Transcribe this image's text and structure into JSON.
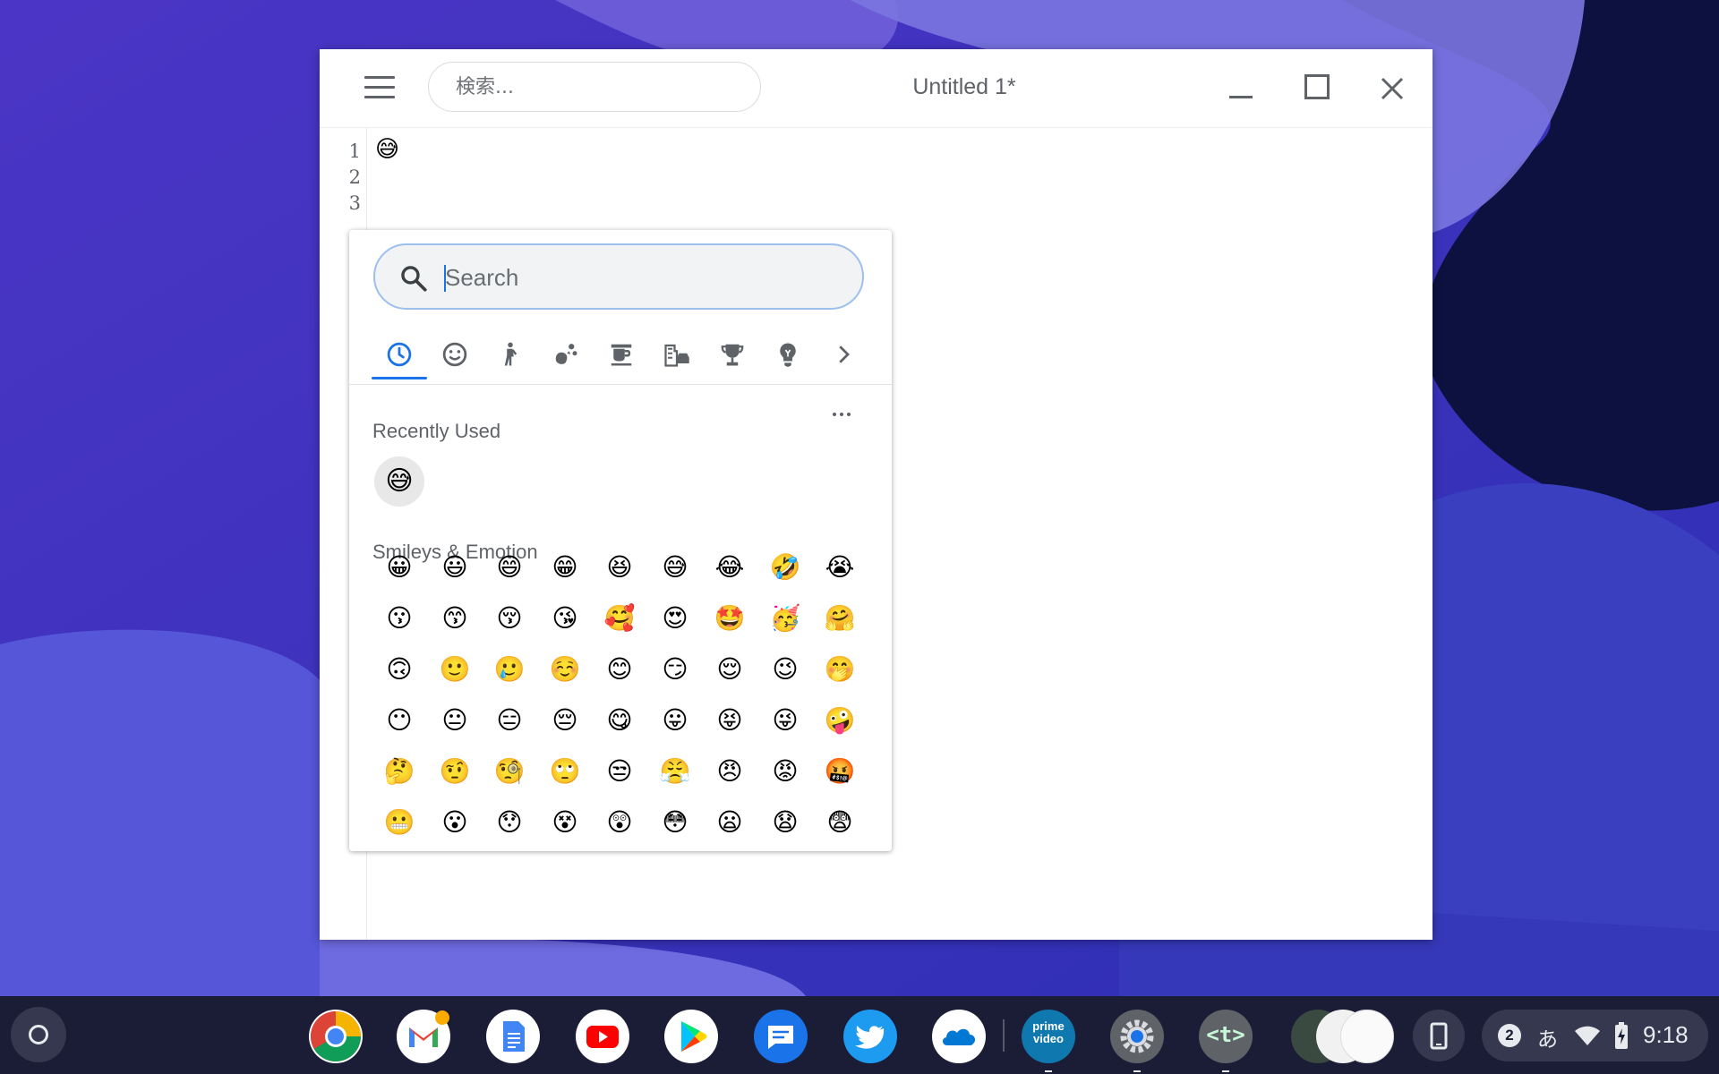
{
  "window": {
    "search_placeholder": "検索...",
    "title": "Untitled 1*"
  },
  "editor": {
    "line_numbers": [
      "1",
      "2",
      "3"
    ],
    "content": "😅"
  },
  "emoji_picker": {
    "search_placeholder": "Search",
    "category_icons": [
      "clock-icon",
      "smiley-icon",
      "person-icon",
      "animal-icon",
      "food-icon",
      "travel-icon",
      "trophy-icon",
      "lightbulb-icon",
      "chevron-right-icon"
    ],
    "recently_used_title": "Recently Used",
    "recently_used": [
      "😅"
    ],
    "smileys_title": "Smileys & Emotion",
    "smileys": [
      "😀",
      "😃",
      "😄",
      "😁",
      "😆",
      "😅",
      "😂",
      "🤣",
      "😭",
      "😗",
      "😙",
      "😚",
      "😘",
      "🥰",
      "😍",
      "🤩",
      "🥳",
      "🤗",
      "🙃",
      "🙂",
      "🥲",
      "☺️",
      "😊",
      "😏",
      "😌",
      "😉",
      "🤭",
      "😶",
      "😐",
      "😑",
      "😔",
      "😋",
      "😛",
      "😝",
      "😜",
      "🤪",
      "🤔",
      "🤨",
      "🧐",
      "🙄",
      "😒",
      "😤",
      "😠",
      "😡",
      "🤬",
      "😬",
      "😮",
      "😯",
      "😵",
      "😲",
      "😳",
      "😦",
      "😧",
      "😨"
    ],
    "accent_color": "#1a73e8"
  },
  "shelf": {
    "apps": [
      "chrome-icon",
      "gmail-icon",
      "docs-icon",
      "youtube-icon",
      "play-store-icon",
      "messages-icon",
      "twitter-icon",
      "onedrive-icon",
      "prime-video-icon",
      "settings-icon",
      "text-app-icon"
    ],
    "prime_video_label": "prime video",
    "text_app_label": "<t>",
    "notification_count": "2",
    "ime": "あ",
    "time": "9:18"
  }
}
